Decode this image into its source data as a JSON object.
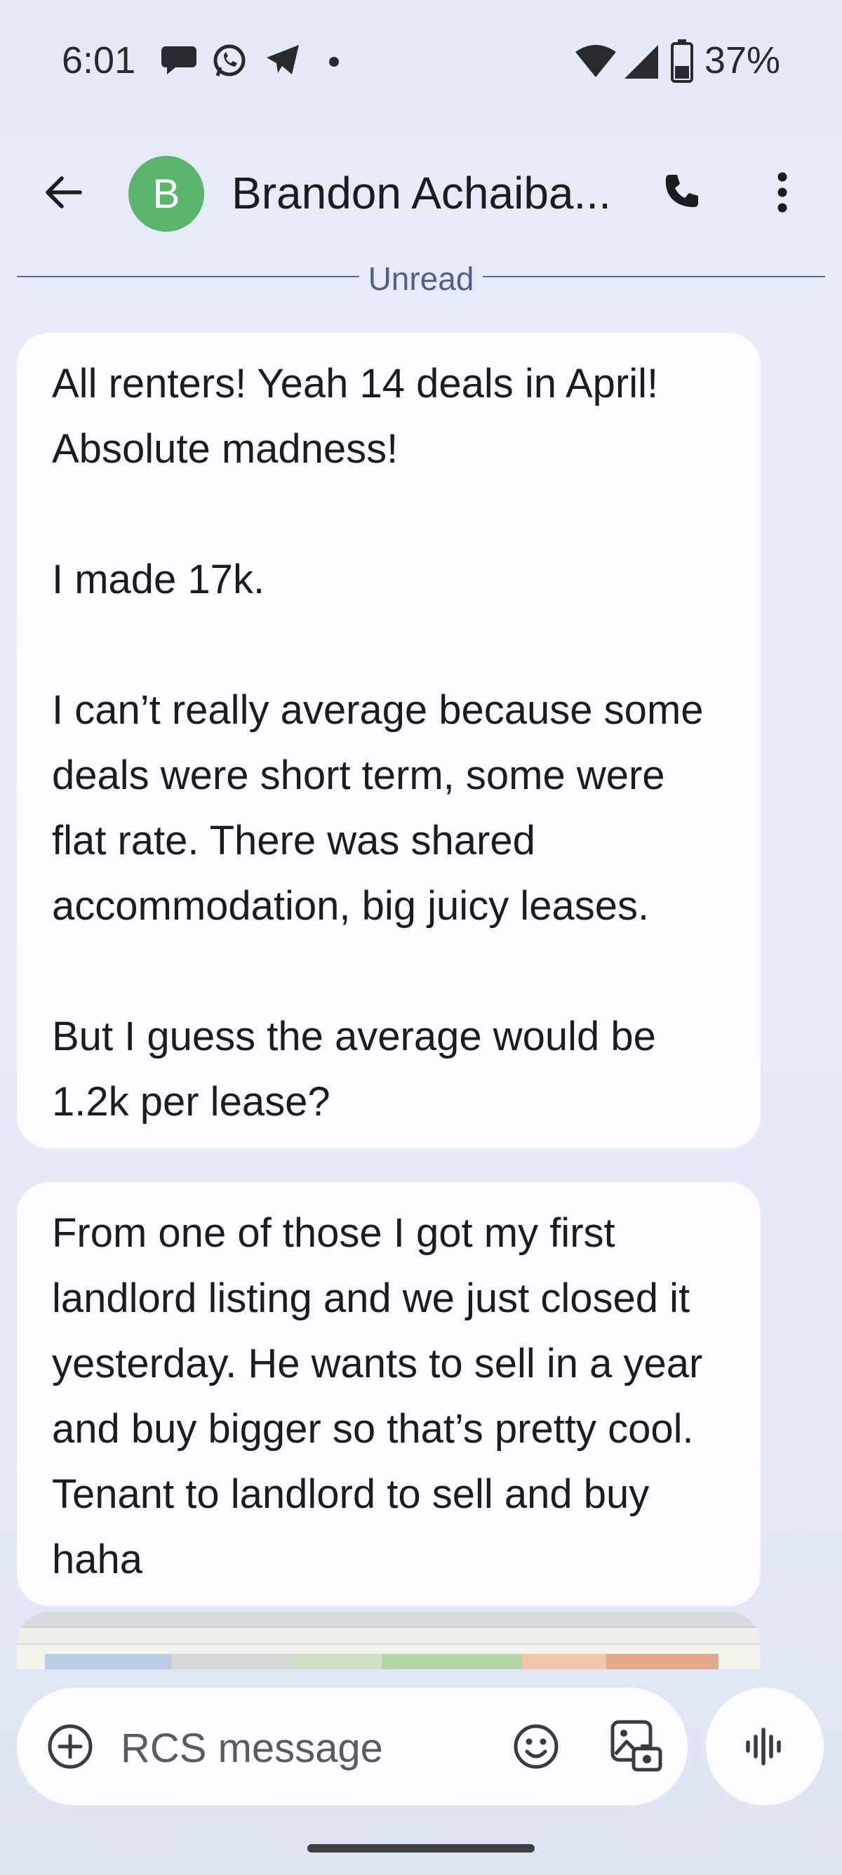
{
  "status_bar": {
    "time": "6:01",
    "battery": "37%",
    "icons": [
      "chat-bubble-icon",
      "whatsapp-icon",
      "telegram-icon",
      "dot-icon",
      "wifi-icon",
      "signal-icon",
      "battery-icon"
    ]
  },
  "header": {
    "avatar_initial": "B",
    "avatar_color": "#5cb56d",
    "contact_name": "Brandon Achaiba..."
  },
  "divider": {
    "label": "Unread"
  },
  "messages": [
    {
      "text": "All renters! Yeah 14 deals in April! Absolute madness!\n\nI made 17k.\n\nI can’t really average because some deals were short term, some were flat rate. There was shared accommodation, big juicy leases.\n\nBut I guess the average would be 1.2k per lease?"
    },
    {
      "text": "From one of those I got my first landlord listing and we just closed it yesterday. He wants to sell in a year and buy bigger so that’s pretty cool. Tenant to landlord to sell and buy haha"
    }
  ],
  "compose": {
    "placeholder": "RCS message"
  },
  "colors": {
    "background": "#e6e9f7",
    "bubble": "#fdfbff",
    "accent": "#4f5f8f"
  }
}
